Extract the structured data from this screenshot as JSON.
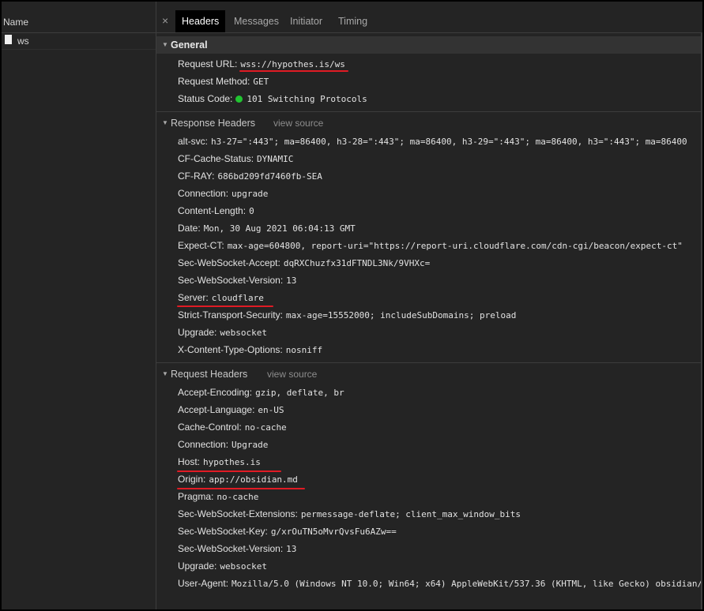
{
  "left": {
    "column_header": "Name",
    "request_name": "ws"
  },
  "tabs": [
    {
      "label": "Headers"
    },
    {
      "label": "Messages"
    },
    {
      "label": "Initiator"
    },
    {
      "label": "Timing"
    }
  ],
  "close_glyph": "×",
  "general": {
    "title": "General",
    "rows": [
      {
        "k": "Request URL:",
        "v": "wss://hypothes.is/ws"
      },
      {
        "k": "Request Method:",
        "v": "GET"
      },
      {
        "k": "Status Code:",
        "v": "101 Switching Protocols",
        "status_color": "#21c431"
      }
    ]
  },
  "response_headers": {
    "title": "Response Headers",
    "view_source": "view source",
    "rows": [
      {
        "k": "alt-svc:",
        "v": "h3-27=\":443\"; ma=86400, h3-28=\":443\"; ma=86400, h3-29=\":443\"; ma=86400, h3=\":443\"; ma=86400"
      },
      {
        "k": "CF-Cache-Status:",
        "v": "DYNAMIC"
      },
      {
        "k": "CF-RAY:",
        "v": "686bd209fd7460fb-SEA"
      },
      {
        "k": "Connection:",
        "v": "upgrade"
      },
      {
        "k": "Content-Length:",
        "v": "0"
      },
      {
        "k": "Date:",
        "v": "Mon, 30 Aug 2021 06:04:13 GMT"
      },
      {
        "k": "Expect-CT:",
        "v": "max-age=604800, report-uri=\"https://report-uri.cloudflare.com/cdn-cgi/beacon/expect-ct\""
      },
      {
        "k": "Sec-WebSocket-Accept:",
        "v": "dqRXChuzfx31dFTNDL3Nk/9VHXc="
      },
      {
        "k": "Sec-WebSocket-Version:",
        "v": "13"
      },
      {
        "k": "Server:",
        "v": "cloudflare"
      },
      {
        "k": "Strict-Transport-Security:",
        "v": "max-age=15552000; includeSubDomains; preload"
      },
      {
        "k": "Upgrade:",
        "v": "websocket"
      },
      {
        "k": "X-Content-Type-Options:",
        "v": "nosniff"
      }
    ]
  },
  "request_headers": {
    "title": "Request Headers",
    "view_source": "view source",
    "rows": [
      {
        "k": "Accept-Encoding:",
        "v": "gzip, deflate, br"
      },
      {
        "k": "Accept-Language:",
        "v": "en-US"
      },
      {
        "k": "Cache-Control:",
        "v": "no-cache"
      },
      {
        "k": "Connection:",
        "v": "Upgrade"
      },
      {
        "k": "Host:",
        "v": "hypothes.is"
      },
      {
        "k": "Origin:",
        "v": "app://obsidian.md"
      },
      {
        "k": "Pragma:",
        "v": "no-cache"
      },
      {
        "k": "Sec-WebSocket-Extensions:",
        "v": "permessage-deflate; client_max_window_bits"
      },
      {
        "k": "Sec-WebSocket-Key:",
        "v": "g/xrOuTN5oMvrQvsFu6AZw=="
      },
      {
        "k": "Sec-WebSocket-Version:",
        "v": "13"
      },
      {
        "k": "Upgrade:",
        "v": "websocket"
      },
      {
        "k": "User-Agent:",
        "v": "Mozilla/5.0 (Windows NT 10.0; Win64; x64) AppleWebKit/537.36 (KHTML, like Gecko) obsidian/"
      }
    ]
  },
  "annotation_color": "#e01b24"
}
